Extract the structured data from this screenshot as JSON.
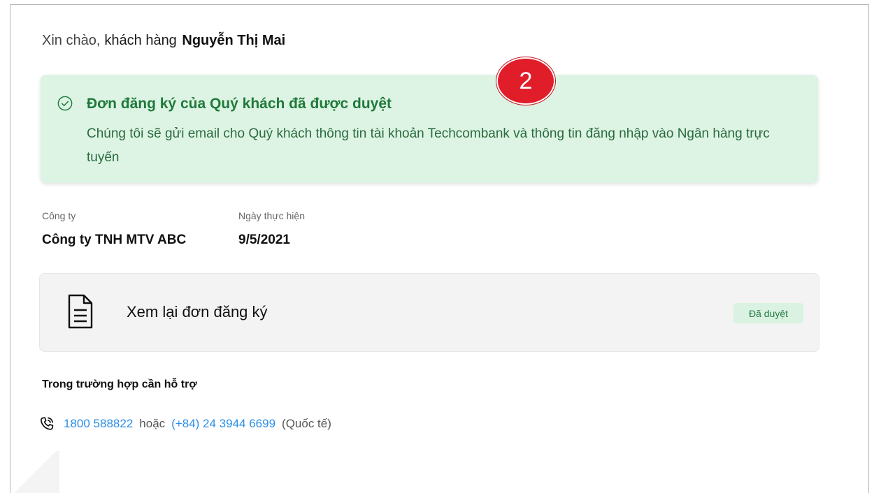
{
  "greeting": {
    "hello": "Xin chào,",
    "customer_label": "khách hàng",
    "customer_name": "Nguyễn Thị Mai"
  },
  "step_badge": {
    "number": "2",
    "color": "#e11d2a"
  },
  "approval_notice": {
    "icon": "check-circle-icon",
    "title": "Đơn đăng ký của Quý khách đã được duyệt",
    "description": "Chúng tôi sẽ gửi email cho Quý khách thông tin tài khoản Techcombank và thông tin đăng nhập vào Ngân hàng trực tuyến",
    "background": "#ddf4e4",
    "accent": "#1f7a3a"
  },
  "details": {
    "company_label": "Công ty",
    "company_value": "Công ty TNH MTV ABC",
    "date_label": "Ngày thực hiện",
    "date_value": "9/5/2021"
  },
  "review": {
    "icon": "document-icon",
    "label": "Xem lại đơn đăng ký",
    "status": "Đã duyệt"
  },
  "support": {
    "title": "Trong trường hợp cần hỗ trợ",
    "icon": "phone-icon",
    "hotline": "1800 588822",
    "separator": "hoặc",
    "international": "(+84) 24 3944 6699",
    "international_note": "(Quốc tế)",
    "link_color": "#2b8ee6"
  }
}
